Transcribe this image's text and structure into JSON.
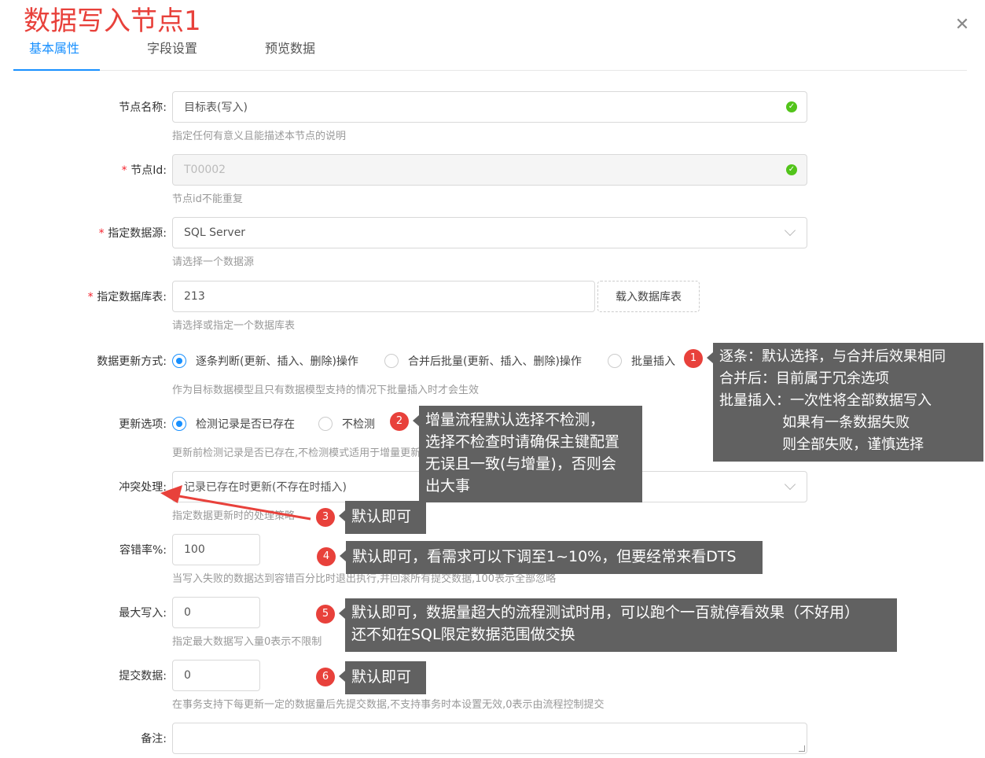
{
  "overlay_title": "数据写入节点1",
  "tabs": [
    "基本属性",
    "字段设置",
    "预览数据"
  ],
  "fields": {
    "node_name": {
      "label": "节点名称:",
      "value": "目标表(写入)",
      "help": "指定任何有意义且能描述本节点的说明"
    },
    "node_id": {
      "required": "*",
      "label": "节点Id:",
      "value": "T00002",
      "help": "节点id不能重复"
    },
    "datasource": {
      "required": "*",
      "label": "指定数据源:",
      "value": "SQL Server",
      "help": "请选择一个数据源"
    },
    "db_table": {
      "required": "*",
      "label": "指定数据库表:",
      "value": "213",
      "button": "载入数据库表",
      "help": "请选择或指定一个数据库表"
    },
    "update_mode": {
      "label": "数据更新方式:",
      "options": [
        "逐条判断(更新、插入、删除)操作",
        "合并后批量(更新、插入、删除)操作",
        "批量插入"
      ],
      "selected": 0,
      "help": "作为目标数据模型且只有数据模型支持的情况下批量插入时才会生效"
    },
    "update_option": {
      "label": "更新选项:",
      "options": [
        "检测记录是否已存在",
        "不检测"
      ],
      "selected": 0,
      "help": "更新前检测记录是否已存在,不检测模式适用于增量更新且数据量大的场景时使用"
    },
    "conflict": {
      "label": "冲突处理:",
      "value": "记录已存在时更新(不存在时插入)",
      "help": "指定数据更新时的处理策略"
    },
    "error_rate": {
      "label": "容错率%:",
      "value": "100",
      "help": "当写入失败的数据达到容错百分比时退出执行,并回滚所有提交数据,100表示全部忽略"
    },
    "max_write": {
      "label": "最大写入:",
      "value": "0",
      "help": "指定最大数据写入量0表示不限制"
    },
    "commit": {
      "label": "提交数据:",
      "value": "0",
      "help": "在事务支持下每更新一定的数据量后先提交数据,不支持事务时本设置无效,0表示由流程控制提交"
    },
    "remark": {
      "label": "备注:",
      "value": ""
    }
  },
  "annotations": [
    {
      "num": "1",
      "text": "逐条：默认选择，与合并后效果相同\n合并后：目前属于冗余选项\n批量插入：一次性将全部数据写入\n              如果有一条数据失败\n              则全部失败，谨慎选择"
    },
    {
      "num": "2",
      "text": "增量流程默认选择不检测，\n选择不检查时请确保主键配置\n无误且一致(与增量)，否则会\n出大事"
    },
    {
      "num": "3",
      "text": "默认即可"
    },
    {
      "num": "4",
      "text": "默认即可，看需求可以下调至1~10%，但要经常来看DTS"
    },
    {
      "num": "5",
      "text": "默认即可，数据量超大的流程测试时用，可以跑个一百就停看效果（不好用）\n还不如在SQL限定数据范围做交换"
    },
    {
      "num": "6",
      "text": "默认即可"
    }
  ],
  "colors": {
    "accent": "#1890ff",
    "annotation_red": "#e8413b",
    "note_bg": "#616161",
    "success": "#52c41a"
  },
  "icons": {
    "close": "close-icon",
    "ok": "check-circle-icon",
    "select": "chevron-down-icon"
  }
}
